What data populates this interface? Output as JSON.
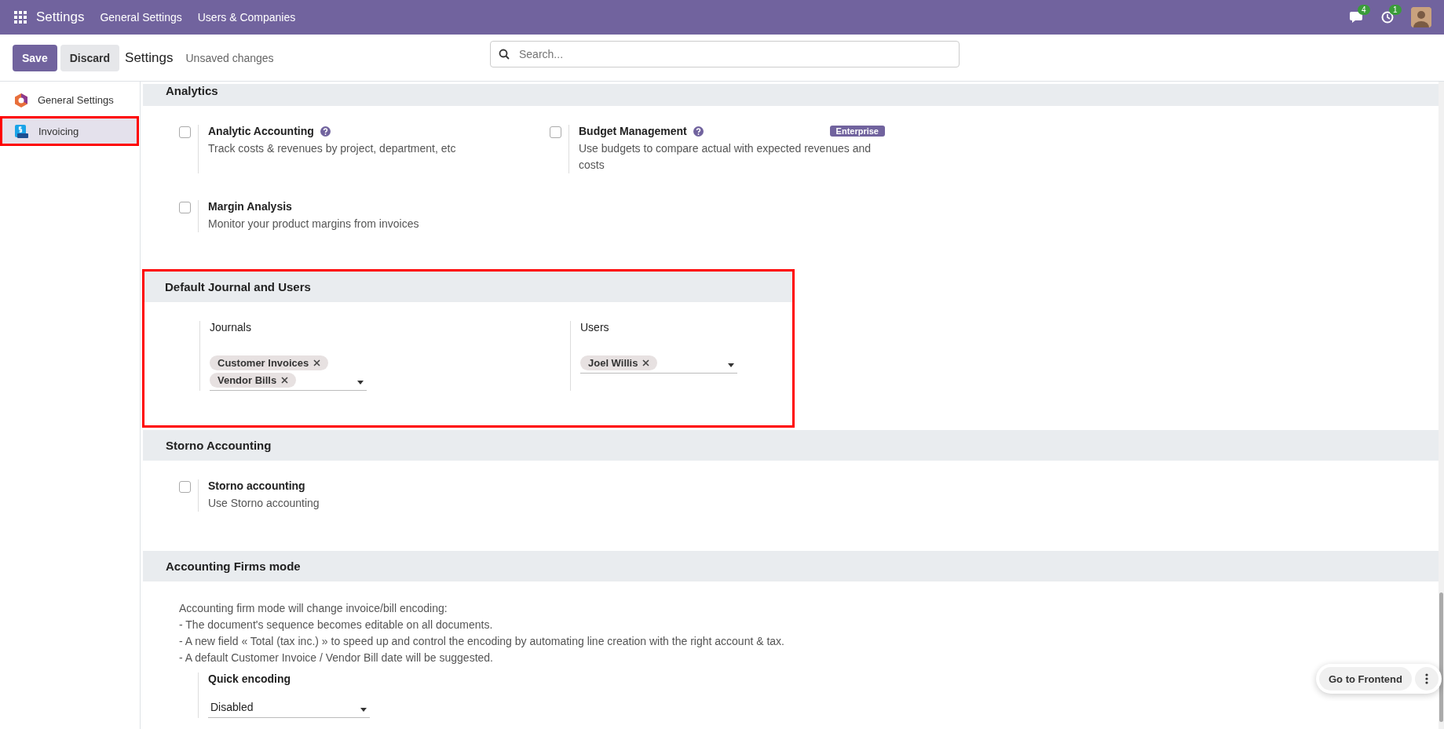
{
  "topbar": {
    "app": "Settings",
    "menu": [
      "General Settings",
      "Users & Companies"
    ],
    "messages_badge": "4",
    "activities_badge": "1"
  },
  "control_panel": {
    "save": "Save",
    "discard": "Discard",
    "title": "Settings",
    "status": "Unsaved changes",
    "search": {
      "placeholder": "Search..."
    }
  },
  "sidebar": {
    "items": [
      {
        "label": "General Settings",
        "kind": "general",
        "selected": false,
        "highlighted": false
      },
      {
        "label": "Invoicing",
        "kind": "invoicing",
        "selected": true,
        "highlighted": true
      }
    ]
  },
  "sections": [
    {
      "title": "Analytics",
      "highlighted": false,
      "settings": [
        {
          "kind": "checkbox",
          "label": "Analytic Accounting",
          "help": true,
          "description": "Track costs & revenues by project, department, etc",
          "checked": false
        },
        {
          "kind": "checkbox",
          "label": "Budget Management",
          "help": true,
          "badge": "Enterprise",
          "description": "Use budgets to compare actual with expected revenues and costs",
          "checked": false
        },
        {
          "kind": "checkbox",
          "label": "Margin Analysis",
          "help": false,
          "description": "Monitor your product margins from invoices",
          "checked": false
        }
      ]
    },
    {
      "title": "Default Journal and Users",
      "highlighted": true,
      "settings": [
        {
          "kind": "tags",
          "label": "Journals",
          "tags": [
            "Customer Invoices",
            "Vendor Bills"
          ]
        },
        {
          "kind": "tags",
          "label": "Users",
          "tags": [
            "Joel Willis"
          ]
        }
      ]
    },
    {
      "title": "Storno Accounting",
      "highlighted": false,
      "settings": [
        {
          "kind": "checkbox",
          "label": "Storno accounting",
          "help": false,
          "description": "Use Storno accounting",
          "checked": false
        }
      ]
    },
    {
      "title": "Accounting Firms mode",
      "highlighted": false,
      "intro": [
        "Accounting firm mode will change invoice/bill encoding:",
        "- The document's sequence becomes editable on all documents.",
        "- A new field « Total (tax inc.) » to speed up and control the encoding by automating line creation with the right account & tax.",
        "- A default Customer Invoice / Vendor Bill date will be suggested."
      ],
      "settings": [
        {
          "kind": "select",
          "label": "Quick encoding",
          "value": "Disabled"
        }
      ]
    }
  ],
  "floating": {
    "button": "Go to Frontend"
  }
}
